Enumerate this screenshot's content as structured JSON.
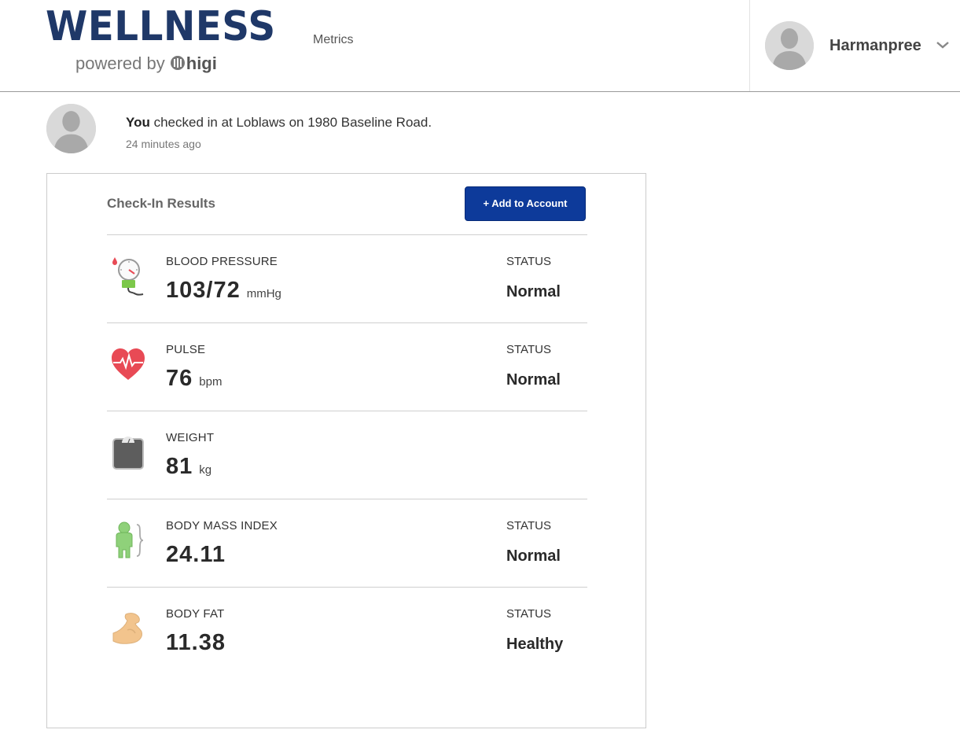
{
  "header": {
    "logo_title": "WELLNESS",
    "logo_powered_by": "powered by",
    "logo_brand": "higi",
    "nav_metrics": "Metrics",
    "user_name": "Harmanpree"
  },
  "checkin": {
    "subject": "You",
    "message": " checked in at Loblaws on 1980 Baseline Road.",
    "time_ago": "24 minutes ago"
  },
  "results": {
    "title": "Check-In Results",
    "add_button": "+ Add to Account",
    "rows": [
      {
        "icon": "blood-pressure-icon",
        "label": "BLOOD PRESSURE",
        "value": "103/72",
        "unit": "mmHg",
        "status_label": "STATUS",
        "status": "Normal"
      },
      {
        "icon": "heart-pulse-icon",
        "label": "PULSE",
        "value": "76",
        "unit": "bpm",
        "status_label": "STATUS",
        "status": "Normal"
      },
      {
        "icon": "scale-icon",
        "label": "WEIGHT",
        "value": "81",
        "unit": "kg",
        "status_label": "",
        "status": ""
      },
      {
        "icon": "body-figure-icon",
        "label": "BODY MASS INDEX",
        "value": "24.11",
        "unit": "",
        "status_label": "STATUS",
        "status": "Normal"
      },
      {
        "icon": "flexed-arm-icon",
        "label": "BODY FAT",
        "value": "11.38",
        "unit": "",
        "status_label": "STATUS",
        "status": "Healthy"
      }
    ]
  },
  "colors": {
    "brand_navy": "#1f3868",
    "button_blue": "#0d3a9a",
    "heart_red": "#e84a55",
    "bmi_green": "#8fd17a",
    "arm_tan": "#f2c48d"
  }
}
